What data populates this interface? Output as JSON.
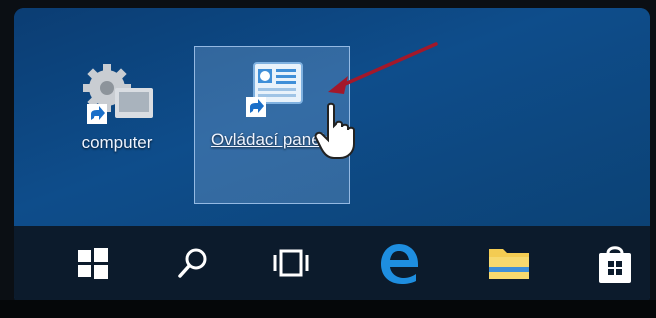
{
  "desktop": {
    "icons": [
      {
        "label": "computer"
      },
      {
        "label": "Ovládací panely",
        "selected": true
      }
    ]
  },
  "taskbar": {
    "items": [
      {
        "icon": "windows-start-icon"
      },
      {
        "icon": "search-icon"
      },
      {
        "icon": "task-view-icon"
      },
      {
        "icon": "edge-icon"
      },
      {
        "icon": "file-explorer-icon"
      },
      {
        "icon": "store-icon"
      }
    ]
  },
  "colors": {
    "desktop": "#0d4a86",
    "taskbar": "#0c1b2c",
    "selection": "#96bee8",
    "annotation_arrow": "#a3182a",
    "edge_blue": "#1e8ee0",
    "folder_yellow": "#f4cc52"
  }
}
